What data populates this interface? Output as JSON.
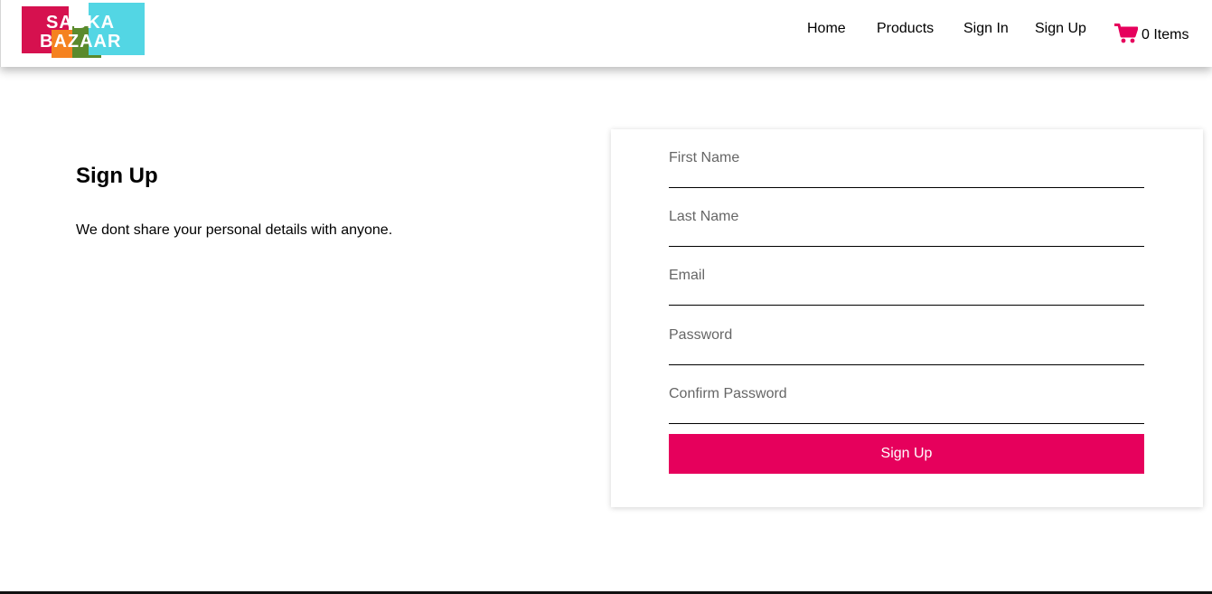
{
  "logo": {
    "line1": "SABKA",
    "line2": "BAZAAR"
  },
  "nav": {
    "home": "Home",
    "products": "Products",
    "sign_in": "Sign In",
    "sign_up": "Sign Up"
  },
  "cart": {
    "label": "0 Items",
    "icon": "cart-icon",
    "color": "#e6005c"
  },
  "intro": {
    "title": "Sign Up",
    "subtitle": "We dont share your personal details with anyone."
  },
  "form": {
    "first_name": {
      "placeholder": "First Name",
      "value": ""
    },
    "last_name": {
      "placeholder": "Last Name",
      "value": ""
    },
    "email": {
      "placeholder": "Email",
      "value": ""
    },
    "password": {
      "placeholder": "Password",
      "value": ""
    },
    "confirm_password": {
      "placeholder": "Confirm Password",
      "value": ""
    },
    "submit_label": "Sign Up"
  },
  "colors": {
    "accent": "#e6005c"
  }
}
